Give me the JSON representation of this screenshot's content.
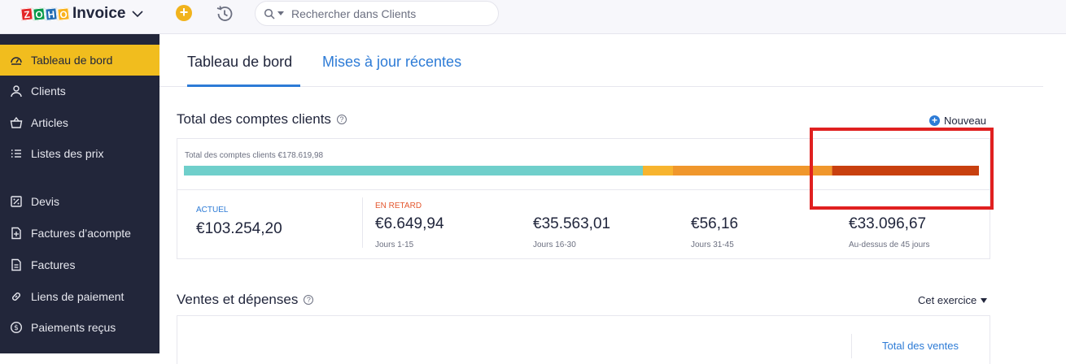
{
  "brand": {
    "logo_letters": [
      "Z",
      "O",
      "H",
      "O"
    ],
    "logo_colors": [
      "#e42527",
      "#089949",
      "#226db4",
      "#f9b21d"
    ],
    "app_name": "Invoice"
  },
  "search": {
    "placeholder": "Rechercher dans Clients"
  },
  "sidebar": {
    "items": [
      {
        "label": "Tableau de bord",
        "icon": "dashboard-icon",
        "active": true
      },
      {
        "label": "Clients",
        "icon": "user-icon"
      },
      {
        "label": "Articles",
        "icon": "basket-icon"
      },
      {
        "label": "Listes des prix",
        "icon": "list-icon"
      },
      {
        "label": "Devis",
        "icon": "quote-icon"
      },
      {
        "label": "Factures d’acompte",
        "icon": "retainer-icon"
      },
      {
        "label": "Factures",
        "icon": "invoice-icon"
      },
      {
        "label": "Liens de paiement",
        "icon": "link-icon"
      },
      {
        "label": "Paiements reçus",
        "icon": "payment-icon"
      }
    ]
  },
  "tabs": [
    {
      "label": "Tableau de bord",
      "active": true
    },
    {
      "label": "Mises à jour récentes",
      "active": false
    }
  ],
  "receivables": {
    "title": "Total des comptes clients",
    "new_label": "Nouveau",
    "total_label": "Total des comptes clients €178.619,98",
    "bar_colors": [
      "#6fcfcb",
      "#f7b42f",
      "#f0972c",
      "#c8400f"
    ],
    "current": {
      "caption": "ACTUEL",
      "value": "€103.254,20"
    },
    "overdue_caption": "EN RETARD",
    "buckets": [
      {
        "value": "€6.649,94",
        "sub": "Jours 1-15"
      },
      {
        "value": "€35.563,01",
        "sub": "Jours 16-30"
      },
      {
        "value": "€56,16",
        "sub": "Jours 31-45"
      },
      {
        "value": "€33.096,67",
        "sub": "Au-dessus de 45 jours"
      }
    ]
  },
  "sales": {
    "title": "Ventes et dépenses",
    "period": "Cet exercice",
    "total_sales_label": "Total des ventes"
  }
}
